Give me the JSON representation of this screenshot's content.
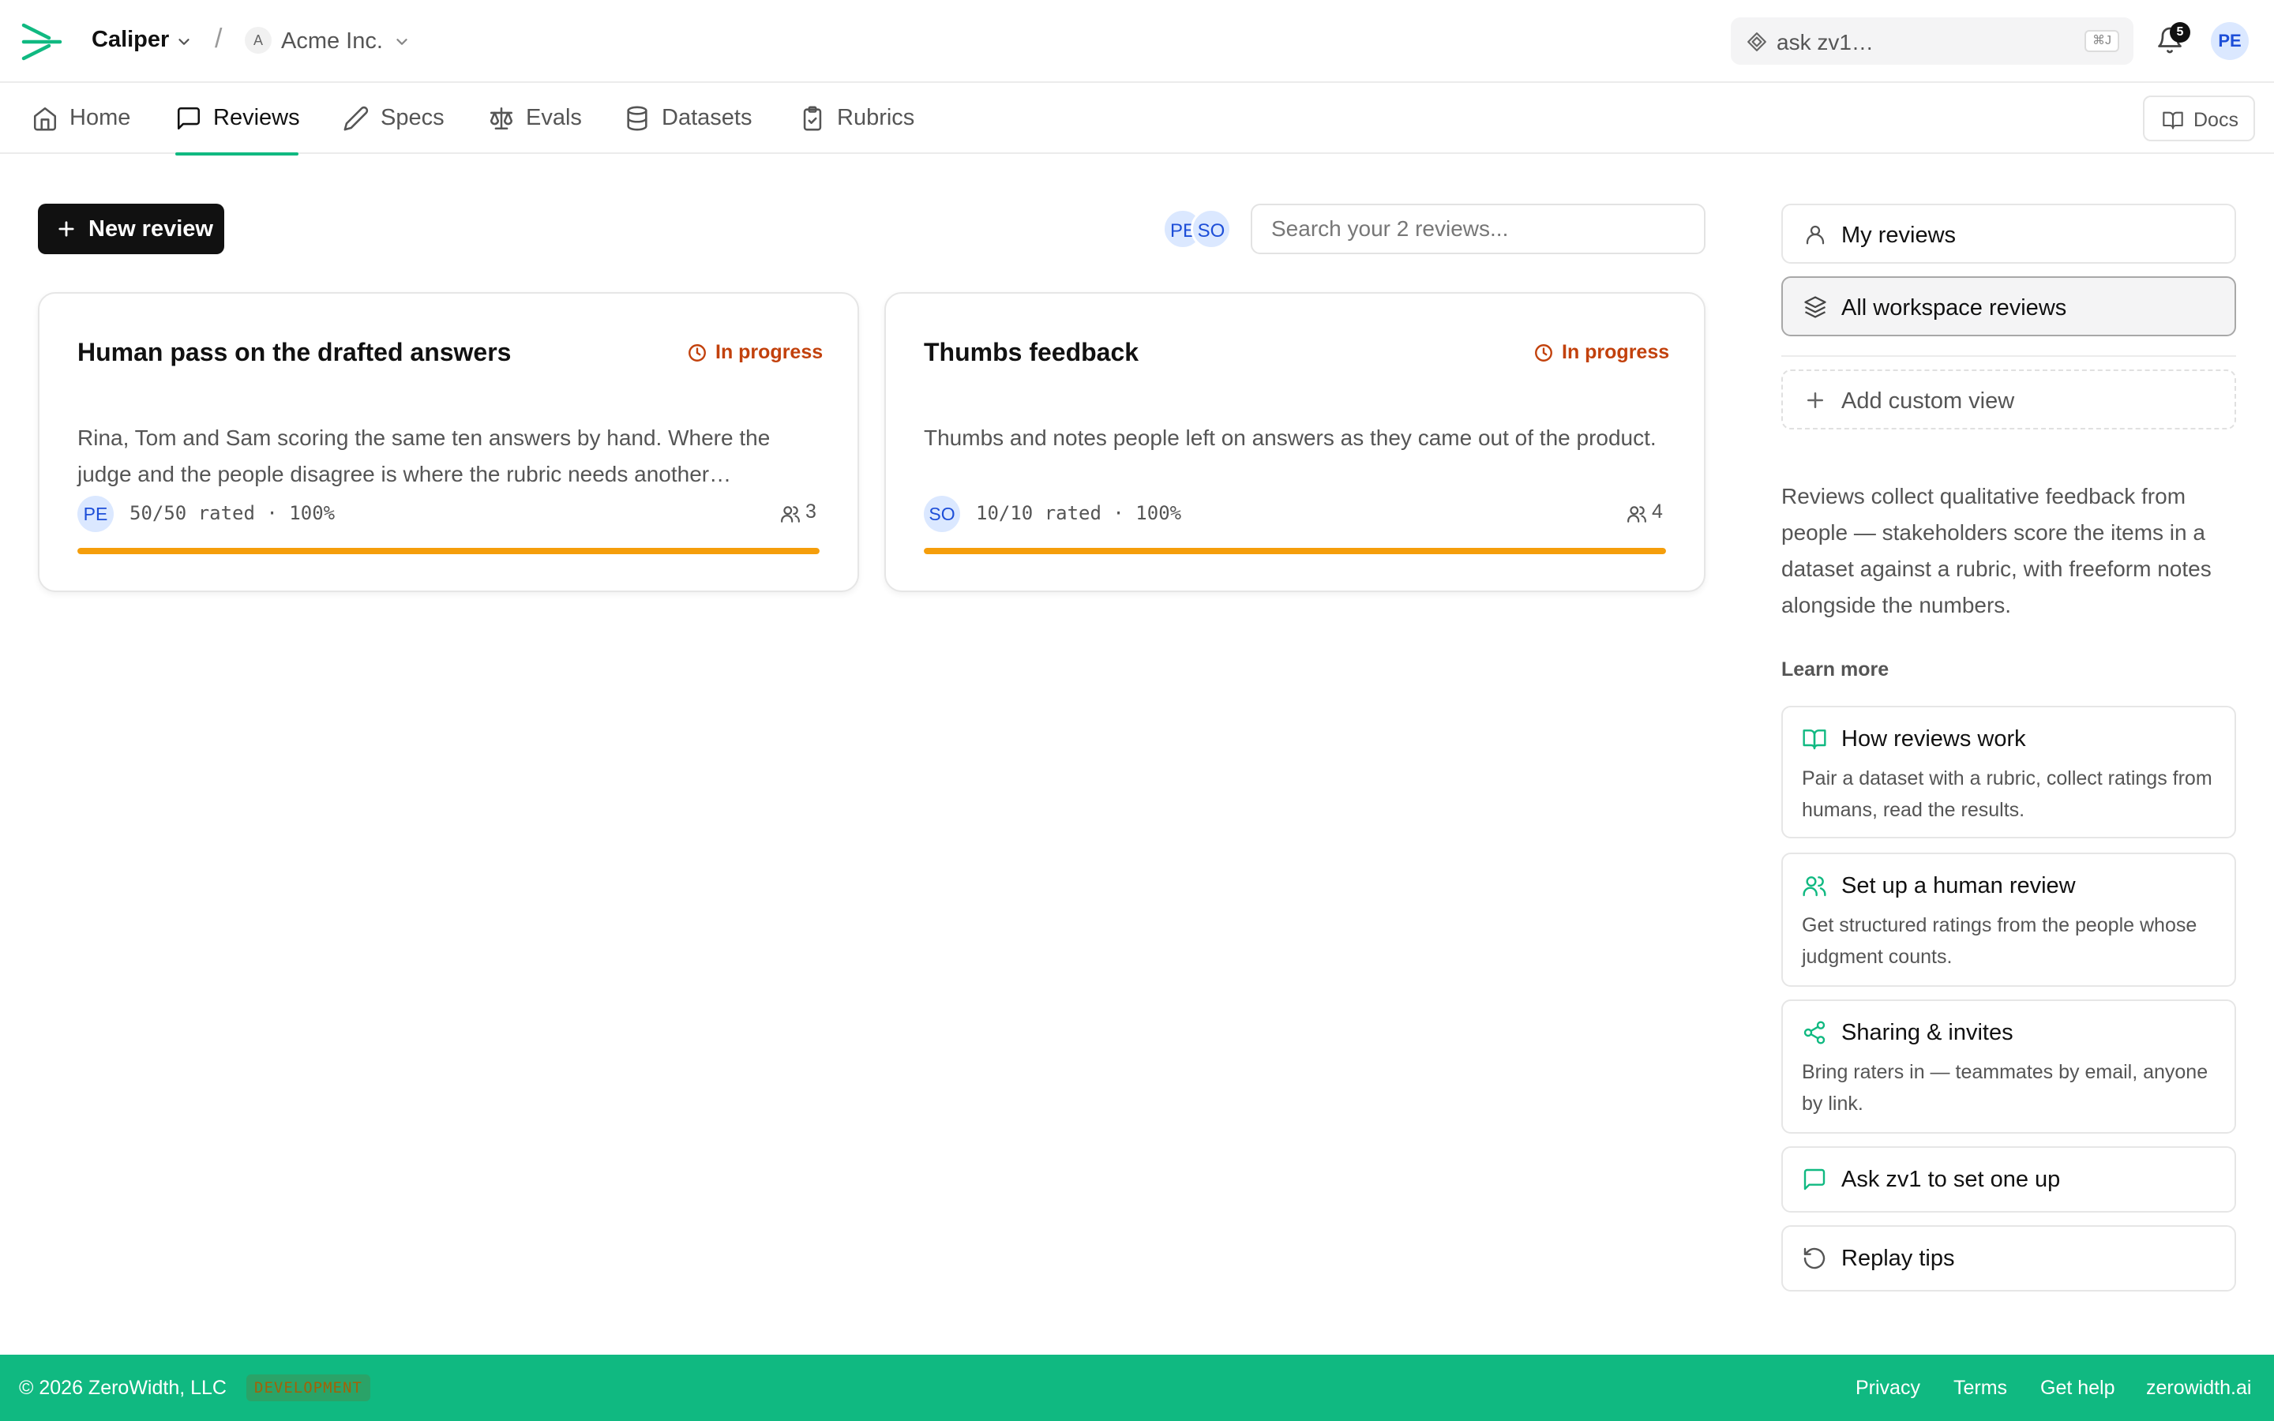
{
  "app": {
    "brand": "Caliper",
    "org_initial": "A",
    "org_name": "Acme Inc.",
    "separator": "/"
  },
  "header": {
    "ask_placeholder": "ask zv1…",
    "ask_shortcut": "⌘J",
    "notifications_count": "5",
    "user_initials": "PE"
  },
  "nav": {
    "tabs": [
      {
        "label": "Home",
        "icon": "home-icon"
      },
      {
        "label": "Reviews",
        "icon": "message-square-icon",
        "active": true
      },
      {
        "label": "Specs",
        "icon": "pencil-icon"
      },
      {
        "label": "Evals",
        "icon": "scale-icon"
      },
      {
        "label": "Datasets",
        "icon": "database-icon"
      },
      {
        "label": "Rubrics",
        "icon": "clipboard-check-icon"
      }
    ],
    "docs_label": "Docs"
  },
  "toolbar": {
    "new_review_label": "New review",
    "participant_avatars": [
      "PE",
      "SO"
    ],
    "search_placeholder": "Search your 2 reviews..."
  },
  "reviews": [
    {
      "title": "Human pass on the drafted answers",
      "status": "In progress",
      "description": "Rina, Tom and Sam scoring the same ten answers by hand. Where the judge and the people disagree is where the rubric needs another…",
      "owner_initials": "PE",
      "rated": "50/50 rated · 100%",
      "progress": 1.0,
      "raters": "3"
    },
    {
      "title": "Thumbs feedback",
      "status": "In progress",
      "description": "Thumbs and notes people left on answers as they came out of the product.",
      "owner_initials": "SO",
      "rated": "10/10 rated · 100%",
      "progress": 1.0,
      "raters": "4"
    }
  ],
  "sidebar": {
    "views": [
      {
        "label": "My reviews",
        "icon": "user-icon"
      },
      {
        "label": "All workspace reviews",
        "icon": "layers-icon",
        "selected": true
      }
    ],
    "add_view_label": "Add custom view",
    "about": "Reviews collect qualitative feedback from people — stakeholders score the items in a dataset against a rubric, with freeform notes alongside the numbers.",
    "learn_more_heading": "Learn more",
    "resources": [
      {
        "title": "How reviews work",
        "description": "Pair a dataset with a rubric, collect ratings from humans, read the results.",
        "icon": "book-open-icon"
      },
      {
        "title": "Set up a human review",
        "description": "Get structured ratings from the people whose judgment counts.",
        "icon": "users-icon"
      },
      {
        "title": "Sharing & invites",
        "description": "Bring raters in — teammates by email, anyone by link.",
        "icon": "share-icon"
      },
      {
        "title": "Ask zv1 to set one up",
        "icon": "message-square-icon"
      },
      {
        "title": "Replay tips",
        "icon": "rotate-ccw-icon"
      }
    ]
  },
  "footer": {
    "copyright": "© 2026 ZeroWidth, LLC",
    "env_badge": "DEVELOPMENT",
    "links": [
      "Privacy",
      "Terms",
      "Get help",
      "zerowidth.ai"
    ]
  },
  "colors": {
    "accent": "#10b981",
    "status_in_progress": "#c2410c",
    "progress_fill": "#f59e0b",
    "avatar_bg": "#dbe8ff",
    "avatar_text": "#1d4ed8",
    "primary_button": "#111111"
  }
}
